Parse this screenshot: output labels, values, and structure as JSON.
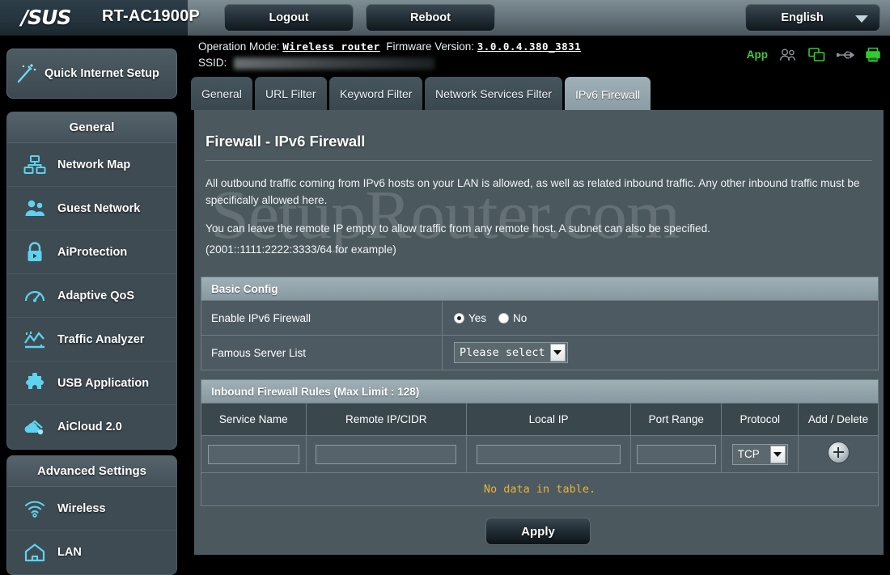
{
  "topbar": {
    "brand": "/SUS",
    "model": "RT-AC1900P",
    "logout_label": "Logout",
    "reboot_label": "Reboot",
    "language": "English"
  },
  "info": {
    "operation_mode_label": "Operation Mode:",
    "operation_mode_value": "Wireless router",
    "firmware_label": "Firmware Version:",
    "firmware_value": "3.0.0.4.380_3831",
    "ssid_label": "SSID:",
    "ssid_value": "",
    "app_label": "App"
  },
  "tabs": [
    {
      "label": "General",
      "active": false
    },
    {
      "label": "URL Filter",
      "active": false
    },
    {
      "label": "Keyword Filter",
      "active": false
    },
    {
      "label": "Network Services Filter",
      "active": false
    },
    {
      "label": "IPv6 Firewall",
      "active": true
    }
  ],
  "sidebar": {
    "quick_setup": "Quick Internet Setup",
    "general_header": "General",
    "general_items": [
      {
        "label": "Network Map",
        "icon": "network-map-icon"
      },
      {
        "label": "Guest Network",
        "icon": "guest-network-icon"
      },
      {
        "label": "AiProtection",
        "icon": "lock-icon"
      },
      {
        "label": "Adaptive QoS",
        "icon": "gauge-icon"
      },
      {
        "label": "Traffic Analyzer",
        "icon": "chart-icon"
      },
      {
        "label": "USB Application",
        "icon": "puzzle-icon"
      },
      {
        "label": "AiCloud 2.0",
        "icon": "cloud-icon"
      }
    ],
    "advanced_header": "Advanced Settings",
    "advanced_items": [
      {
        "label": "Wireless",
        "icon": "wifi-icon"
      },
      {
        "label": "LAN",
        "icon": "home-icon"
      }
    ]
  },
  "page": {
    "title": "Firewall - IPv6 Firewall",
    "desc1": "All outbound traffic coming from IPv6 hosts on your LAN is allowed, as well as related inbound traffic. Any other inbound traffic must be specifically allowed here.",
    "desc2": "You can leave the remote IP empty to allow traffic from any remote host. A subnet can also be specified.",
    "desc3": "(2001::1111:2222:3333/64 for example)"
  },
  "basic_config": {
    "header": "Basic Config",
    "enable_label": "Enable IPv6 Firewall",
    "enable_yes": "Yes",
    "enable_no": "No",
    "enable_value": "Yes",
    "famous_label": "Famous Server List",
    "famous_value": "Please select"
  },
  "rules": {
    "header": "Inbound Firewall Rules (Max Limit : 128)",
    "columns": [
      "Service Name",
      "Remote IP/CIDR",
      "Local IP",
      "Port Range",
      "Protocol",
      "Add / Delete"
    ],
    "entry_row": {
      "service_name": "",
      "remote_ip": "",
      "local_ip": "",
      "port_range": "",
      "protocol": "TCP"
    },
    "empty_message": "No data in table.",
    "rows": []
  },
  "apply_label": "Apply",
  "watermark": "SetupRouter.com",
  "colors": {
    "accent_green": "#39d13a",
    "panel_bg": "#4b585e",
    "section_header": "#9fb0b7",
    "warning_yellow": "#e5b53c",
    "sidebar_icon": "#5fd2f0"
  }
}
